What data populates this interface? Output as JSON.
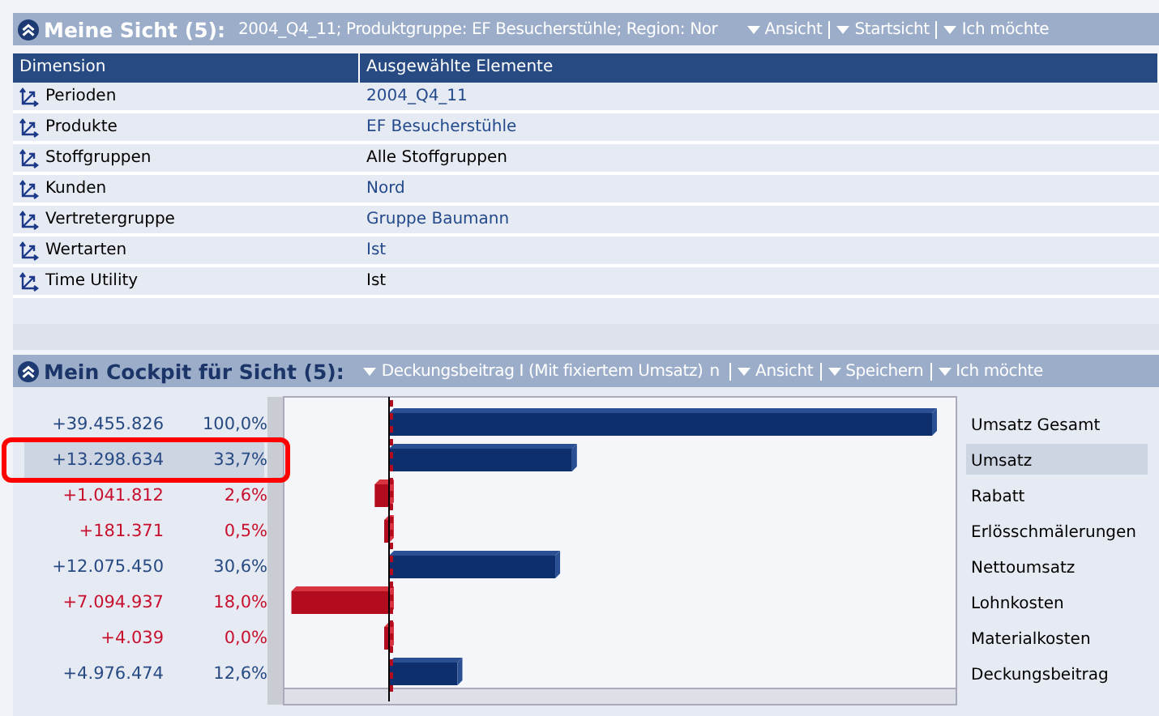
{
  "view_panel": {
    "title": "Meine Sicht (5):",
    "summary": "2004_Q4_11;  Produktgruppe:  EF  Besucherstühle;  Region: Nor",
    "menus": [
      "Ansicht",
      "Startsicht",
      "Ich möchte"
    ],
    "table": {
      "columns": [
        "Dimension",
        "Ausgewählte Elemente"
      ],
      "rows": [
        {
          "dimension": "Perioden",
          "element": "2004_Q4_11",
          "link": true
        },
        {
          "dimension": "Produkte",
          "element": "EF Besucherstühle",
          "link": true
        },
        {
          "dimension": "Stoffgruppen",
          "element": "Alle Stoffgruppen",
          "link": false
        },
        {
          "dimension": "Kunden",
          "element": "Nord",
          "link": true
        },
        {
          "dimension": "Vertretergruppe",
          "element": "Gruppe Baumann",
          "link": true
        },
        {
          "dimension": "Wertarten",
          "element": "Ist",
          "link": true
        },
        {
          "dimension": "Time Utility",
          "element": "Ist",
          "link": false
        }
      ]
    }
  },
  "cockpit_panel": {
    "title": "Mein Cockpit für Sicht (5):",
    "scheme": "Deckungsbeitrag I (Mit fixiertem Umsatz)",
    "fragment": "n",
    "menus": [
      "Ansicht",
      "Speichern",
      "Ich möchte"
    ],
    "rows": [
      {
        "value": "+39.455.826",
        "percent": "100,0%",
        "label": "Umsatz Gesamt",
        "negative": false,
        "selected": false
      },
      {
        "value": "+13.298.634",
        "percent": "33,7%",
        "label": "Umsatz",
        "negative": false,
        "selected": true
      },
      {
        "value": "+1.041.812",
        "percent": "2,6%",
        "label": "Rabatt",
        "negative": true,
        "selected": false
      },
      {
        "value": "+181.371",
        "percent": "0,5%",
        "label": "Erlösschmälerungen",
        "negative": true,
        "selected": false
      },
      {
        "value": "+12.075.450",
        "percent": "30,6%",
        "label": "Nettoumsatz",
        "negative": false,
        "selected": false
      },
      {
        "value": "+7.094.937",
        "percent": "18,0%",
        "label": "Lohnkosten",
        "negative": true,
        "selected": false
      },
      {
        "value": "+4.039",
        "percent": "0,0%",
        "label": "Materialkosten",
        "negative": true,
        "selected": false
      },
      {
        "value": "+4.976.474",
        "percent": "12,6%",
        "label": "Deckungsbeitrag",
        "negative": false,
        "selected": false
      }
    ]
  }
}
